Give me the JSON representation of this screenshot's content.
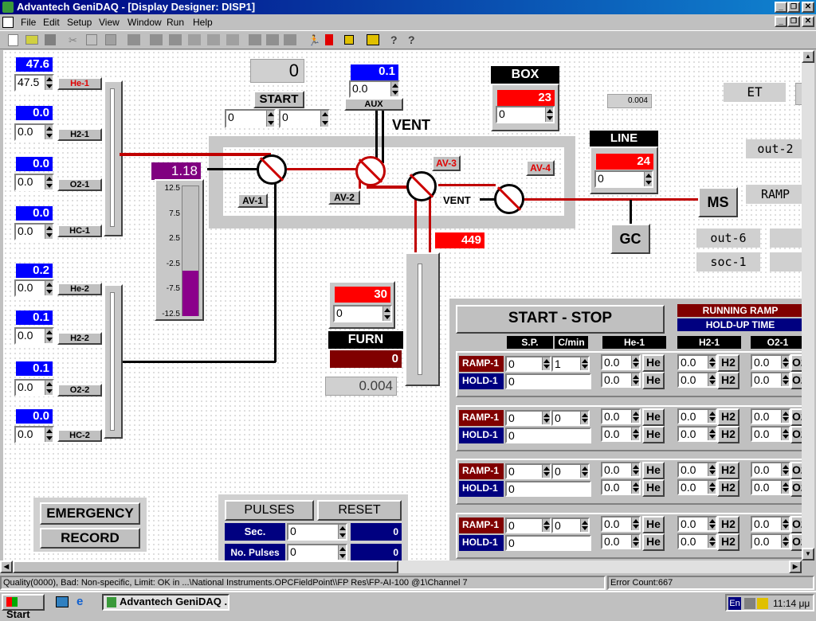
{
  "window": {
    "title": "Advantech GeniDAQ - [Display Designer: DISP1]"
  },
  "menu": [
    "File",
    "Edit",
    "Setup",
    "View",
    "Window",
    "Run",
    "Help"
  ],
  "left": {
    "groups": [
      {
        "label": "He-1",
        "val": "47.6",
        "sp": "47.5"
      },
      {
        "label": "H2-1",
        "val": "0.0",
        "sp": "0.0"
      },
      {
        "label": "O2-1",
        "val": "0.0",
        "sp": "0.0"
      },
      {
        "label": "HC-1",
        "val": "0.0",
        "sp": "0.0"
      },
      {
        "label": "He-2",
        "val": "0.2",
        "sp": "0.0"
      },
      {
        "label": "H2-2",
        "val": "0.1",
        "sp": "0.0"
      },
      {
        "label": "O2-2",
        "val": "0.1",
        "sp": "0.0"
      },
      {
        "label": "HC-2",
        "val": "0.0",
        "sp": "0.0"
      }
    ]
  },
  "counter": {
    "value": "0",
    "start": "START",
    "in1": "0",
    "in2": "0"
  },
  "aux": {
    "val": "0.1",
    "sp": "0.0",
    "label": "AUX"
  },
  "vent": "VENT",
  "vent2": "VENT",
  "box": {
    "title": "BOX",
    "val": "23",
    "sp": "0"
  },
  "line": {
    "title": "LINE",
    "val": "24",
    "sp": "0"
  },
  "small_val": "0.004",
  "labels": {
    "et": "ET",
    "out2": "out-2",
    "ramp": "RAMP",
    "out6": "out-6",
    "soc1": "soc-1",
    "ms": "MS",
    "gc": "GC"
  },
  "valves": {
    "av1": "AV-1",
    "av2": "AV-2",
    "av3": "AV-3",
    "av4": "AV-4"
  },
  "gauge": {
    "value": "1.18",
    "ticks": [
      "12.5",
      "7.5",
      "2.5",
      "-2.5",
      "-7.5",
      "-12.5"
    ],
    "level": 0.35
  },
  "temp449": "449",
  "furn": {
    "val": "30",
    "sp": "0",
    "label": "FURN",
    "out": "0",
    "bottom": "0.004"
  },
  "emergency": "EMERGENCY",
  "record": "RECORD",
  "pulses": {
    "pulses": "PULSES",
    "reset": "RESET",
    "sec": "Sec.",
    "sec_in": "0",
    "sec_out": "0",
    "nopulses": "No. Pulses",
    "np_in": "0",
    "np_out": "0"
  },
  "ramp_panel": {
    "start_stop": "START - STOP",
    "running": "RUNNING RAMP",
    "holdup": "HOLD-UP TIME",
    "headers": {
      "sp": "S.P.",
      "cmin": "C/min",
      "he1": "He-1",
      "h21": "H2-1",
      "o21": "O2-1"
    },
    "rows": [
      {
        "ramp": "RAMP-1",
        "hold": "HOLD-1",
        "sp": "0",
        "cmin": "1",
        "hold_in": "0",
        "he_a": "0.0",
        "he_b": "0.0",
        "h2_a": "0.0",
        "h2_b": "0.0",
        "o2_a": "0.0",
        "o2_b": "0.0"
      },
      {
        "ramp": "RAMP-1",
        "hold": "HOLD-1",
        "sp": "0",
        "cmin": "0",
        "hold_in": "0",
        "he_a": "0.0",
        "he_b": "0.0",
        "h2_a": "0.0",
        "h2_b": "0.0",
        "o2_a": "0.0",
        "o2_b": "0.0"
      },
      {
        "ramp": "RAMP-1",
        "hold": "HOLD-1",
        "sp": "0",
        "cmin": "0",
        "hold_in": "0",
        "he_a": "0.0",
        "he_b": "0.0",
        "h2_a": "0.0",
        "h2_b": "0.0",
        "o2_a": "0.0",
        "o2_b": "0.0"
      },
      {
        "ramp": "RAMP-1",
        "hold": "HOLD-1",
        "sp": "0",
        "cmin": "0",
        "hold_in": "0",
        "he_a": "0.0",
        "he_b": "0.0",
        "h2_a": "0.0",
        "h2_b": "0.0",
        "o2_a": "0.0",
        "o2_b": "0.0"
      }
    ],
    "he_btn": "He",
    "h2_btn": "H2",
    "o2_btn": "O2"
  },
  "status": {
    "text": "Quality(0000), Bad: Non-specific, Limit: OK in ...\\National Instruments.OPCFieldPoint\\\\FP Res\\FP-AI-100 @1\\Channel 7",
    "errors": "Error Count:667"
  },
  "taskbar": {
    "start": "Start",
    "task": "Advantech GeniDAQ ...",
    "lang": "En",
    "time": "11:14 μμ"
  }
}
